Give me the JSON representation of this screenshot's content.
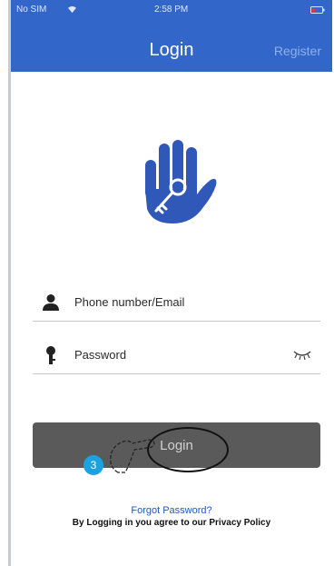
{
  "status_bar": {
    "carrier": "No SIM",
    "time": "2:58 PM"
  },
  "nav": {
    "title": "Login",
    "register_label": "Register"
  },
  "form": {
    "username_placeholder": "Phone number/Email",
    "password_placeholder": "Password"
  },
  "login_button": {
    "label": "Login"
  },
  "step_badge": "3",
  "footer": {
    "forgot_label": "Forgot Password?",
    "policy_text": "By Logging in you agree to our Privacy Policy"
  },
  "colors": {
    "header": "#3266c8",
    "logo": "#2f58b8",
    "button": "#5a5a5a",
    "badge": "#1ba3e1",
    "link": "#2456b8"
  },
  "icons": [
    "wifi-icon",
    "battery-icon",
    "hand-key-logo",
    "user-icon",
    "key-icon",
    "eye-closed-icon",
    "finger-tap-icon"
  ]
}
